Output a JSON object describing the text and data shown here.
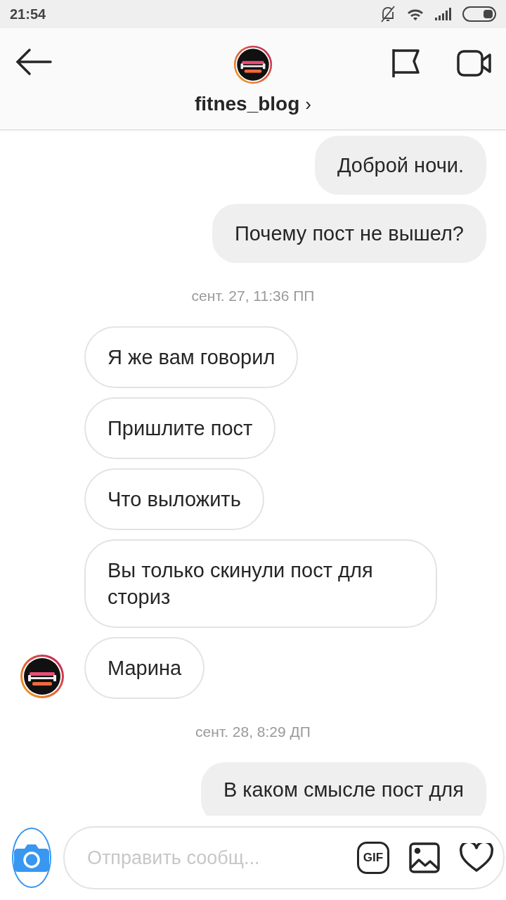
{
  "status_bar": {
    "time": "21:54"
  },
  "header": {
    "username": "fitnes_blog",
    "chevron": "›"
  },
  "messages": [
    {
      "kind": "outgoing",
      "text": "Доброй ночи."
    },
    {
      "kind": "outgoing",
      "text": "Почему пост не вышел?"
    },
    {
      "kind": "timestamp",
      "text": "сент. 27, 11:36 ПП"
    },
    {
      "kind": "incoming_group",
      "texts": [
        "Я же вам говорил",
        "Пришлите пост",
        "Что выложить",
        "Вы только скинули пост для сториз",
        "Марина"
      ]
    },
    {
      "kind": "timestamp",
      "text": "сент. 28, 8:29 ДП"
    },
    {
      "kind": "outgoing",
      "text": "В каком смысле пост для"
    }
  ],
  "composer": {
    "placeholder": "Отправить сообщ...",
    "gif_label": "GIF"
  }
}
